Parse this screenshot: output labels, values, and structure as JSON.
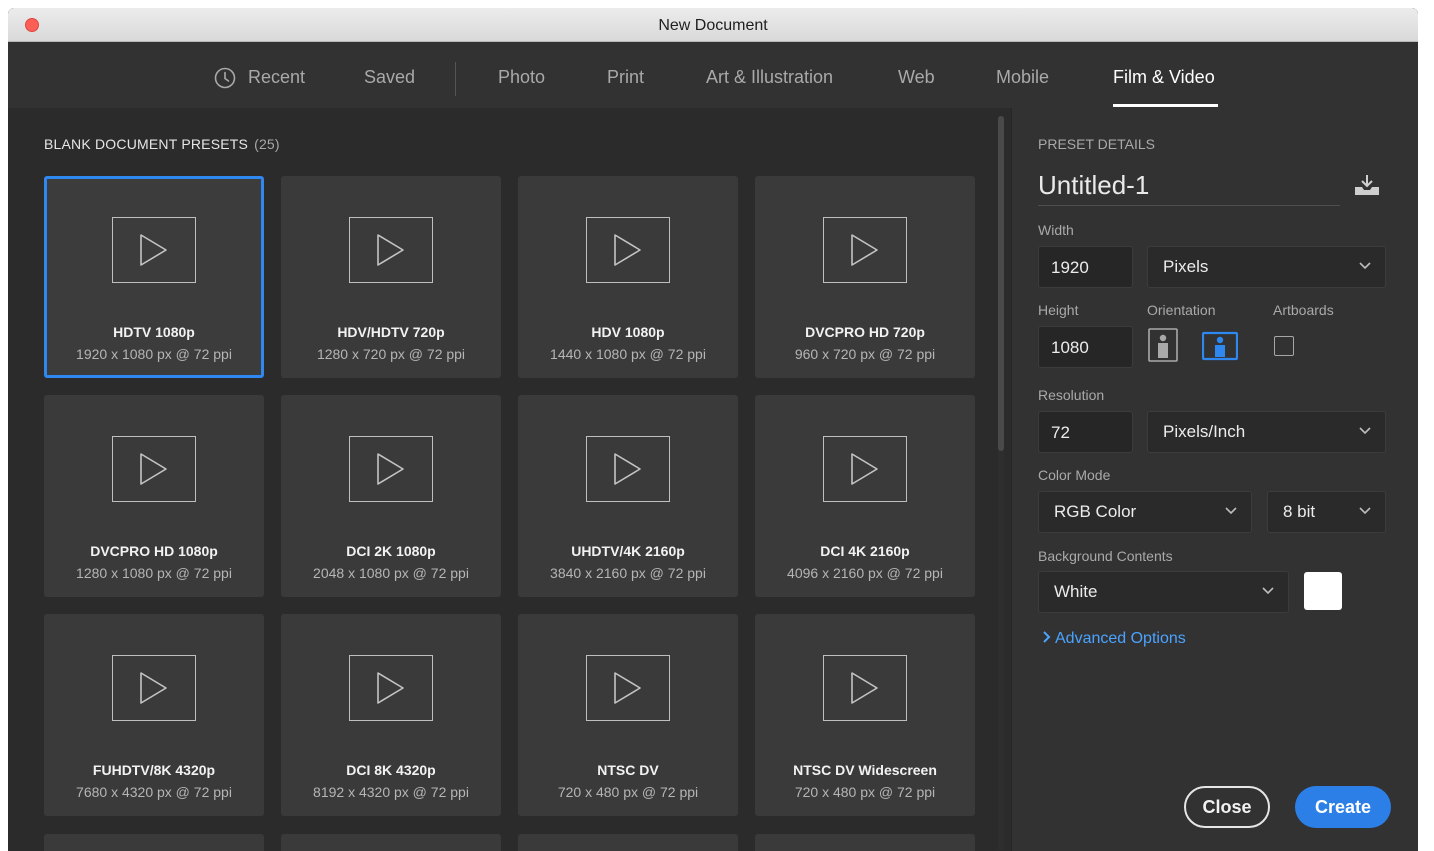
{
  "window": {
    "title": "New Document"
  },
  "tabs": [
    {
      "label": "Recent"
    },
    {
      "label": "Saved"
    },
    {
      "label": "Photo"
    },
    {
      "label": "Print"
    },
    {
      "label": "Art & Illustration"
    },
    {
      "label": "Web"
    },
    {
      "label": "Mobile"
    },
    {
      "label": "Film & Video",
      "active": true
    }
  ],
  "presets": {
    "heading": "BLANK DOCUMENT PRESETS",
    "count": "(25)",
    "items": [
      {
        "name": "HDTV 1080p",
        "dims": "1920 x 1080 px @ 72 ppi",
        "selected": true
      },
      {
        "name": "HDV/HDTV 720p",
        "dims": "1280 x 720 px @ 72 ppi"
      },
      {
        "name": "HDV 1080p",
        "dims": "1440 x 1080 px @ 72 ppi"
      },
      {
        "name": "DVCPRO HD 720p",
        "dims": "960 x 720 px @ 72 ppi"
      },
      {
        "name": "DVCPRO HD 1080p",
        "dims": "1280 x 1080 px @ 72 ppi"
      },
      {
        "name": "DCI 2K 1080p",
        "dims": "2048 x 1080 px @ 72 ppi"
      },
      {
        "name": "UHDTV/4K 2160p",
        "dims": "3840 x 2160 px @ 72 ppi"
      },
      {
        "name": "DCI 4K 2160p",
        "dims": "4096 x 2160 px @ 72 ppi"
      },
      {
        "name": "FUHDTV/8K 4320p",
        "dims": "7680 x 4320 px @ 72 ppi"
      },
      {
        "name": "DCI 8K 4320p",
        "dims": "8192 x 4320 px @ 72 ppi"
      },
      {
        "name": "NTSC DV",
        "dims": "720 x 480 px @ 72 ppi"
      },
      {
        "name": "NTSC DV Widescreen",
        "dims": "720 x 480 px @ 72 ppi"
      }
    ]
  },
  "details": {
    "heading": "PRESET DETAILS",
    "doc_name": "Untitled-1",
    "width_label": "Width",
    "width_value": "1920",
    "width_unit": "Pixels",
    "height_label": "Height",
    "height_value": "1080",
    "orientation_label": "Orientation",
    "orientation_selected": "landscape",
    "artboards_label": "Artboards",
    "artboards_checked": false,
    "resolution_label": "Resolution",
    "resolution_value": "72",
    "resolution_unit": "Pixels/Inch",
    "color_mode_label": "Color Mode",
    "color_mode": "RGB Color",
    "bit_depth": "8 bit",
    "bg_label": "Background Contents",
    "bg_value": "White",
    "bg_color": "#ffffff",
    "advanced": "Advanced Options"
  },
  "buttons": {
    "close": "Close",
    "create": "Create"
  },
  "colors": {
    "accent": "#2d7fe8",
    "link": "#4aa3ff",
    "selection": "#2e88f0"
  }
}
